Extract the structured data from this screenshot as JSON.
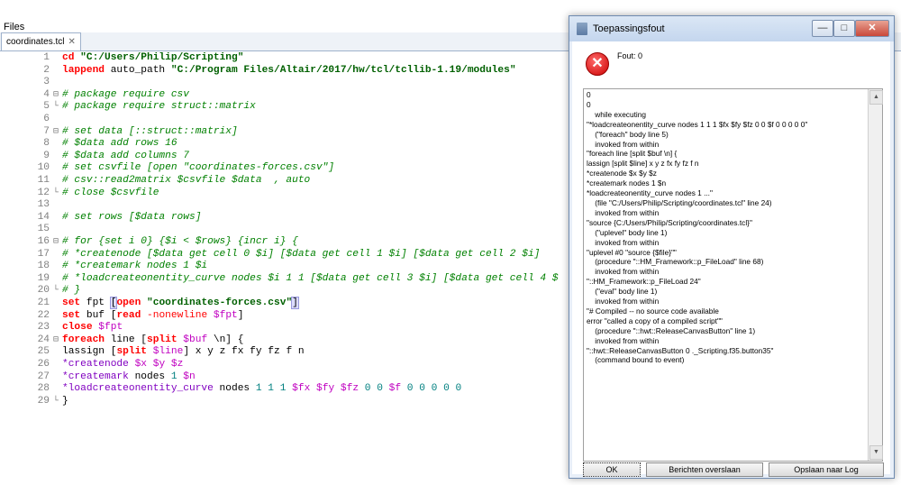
{
  "files_label": "Files",
  "tab": {
    "label": "coordinates.tcl",
    "close": "✕"
  },
  "code_lines": [
    {
      "n": "1",
      "fold": "",
      "html": "<span class=\"kw\">cd</span> <span class=\"strb\">\"C:/Users/Philip/Scripting\"</span>"
    },
    {
      "n": "2",
      "fold": "",
      "html": "<span class=\"kw\">lappend</span> auto_path <span class=\"strb\">\"C:/Program Files/Altair/2017/hw/tcl/tcllib-1.19/modules\"</span>"
    },
    {
      "n": "3",
      "fold": "",
      "html": ""
    },
    {
      "n": "4",
      "fold": "⊟",
      "html": "<span class=\"cm\"># package require csv</span>"
    },
    {
      "n": "5",
      "fold": "└",
      "html": "<span class=\"cm\"># package require struct::matrix</span>"
    },
    {
      "n": "6",
      "fold": "",
      "html": ""
    },
    {
      "n": "7",
      "fold": "⊟",
      "html": "<span class=\"cm\"># set data [::struct::matrix]</span>"
    },
    {
      "n": "8",
      "fold": "",
      "html": "<span class=\"cm\"># $data add rows 16</span>"
    },
    {
      "n": "9",
      "fold": "",
      "html": "<span class=\"cm\"># $data add columns 7</span>"
    },
    {
      "n": "10",
      "fold": "",
      "html": "<span class=\"cm\"># set csvfile [open \"coordinates-forces.csv\"]</span>"
    },
    {
      "n": "11",
      "fold": "",
      "html": "<span class=\"cm\"># csv::read2matrix $csvfile $data  , auto</span>"
    },
    {
      "n": "12",
      "fold": "└",
      "html": "<span class=\"cm\"># close $csvfile</span>"
    },
    {
      "n": "13",
      "fold": "",
      "html": ""
    },
    {
      "n": "14",
      "fold": "",
      "html": "<span class=\"cm\"># set rows [$data rows]</span>"
    },
    {
      "n": "15",
      "fold": "",
      "html": ""
    },
    {
      "n": "16",
      "fold": "⊟",
      "html": "<span class=\"cm\"># for {set i 0} {$i &lt; $rows} {incr i} {</span>"
    },
    {
      "n": "17",
      "fold": "",
      "html": "<span class=\"cm\"># *createnode [$data get cell 0 $i] [$data get cell 1 $i] [$data get cell 2 $i]</span>"
    },
    {
      "n": "18",
      "fold": "",
      "html": "<span class=\"cm\"># *createmark nodes 1 $i</span>"
    },
    {
      "n": "19",
      "fold": "",
      "html": "<span class=\"cm\"># *loadcreateonentity_curve nodes $i 1 1 [$data get cell 3 $i] [$data get cell 4 $</span>"
    },
    {
      "n": "20",
      "fold": "└",
      "html": "<span class=\"cm\"># }</span>"
    },
    {
      "n": "21",
      "fold": "",
      "html": "<span class=\"kw\">set</span> fpt <span class=\"hl\">[</span><span class=\"kw\">open</span> <span class=\"strb\">\"coordinates-forces.csv\"</span><span class=\"hl\">]</span>"
    },
    {
      "n": "22",
      "fold": "",
      "html": "<span class=\"kw\">set</span> buf [<span class=\"kw\">read</span> <span class=\"kw2\">-nonewline</span> <span class=\"var\">$fpt</span>]"
    },
    {
      "n": "23",
      "fold": "",
      "html": "<span class=\"kw\">close</span> <span class=\"var\">$fpt</span>"
    },
    {
      "n": "24",
      "fold": "⊟",
      "html": "<span class=\"kw\">foreach</span> line [<span class=\"kw\">split</span> <span class=\"var\">$buf</span> \\n] {"
    },
    {
      "n": "25",
      "fold": "",
      "html": "lassign [<span class=\"kw\">split</span> <span class=\"var\">$line</span>] x y z fx fy fz f n"
    },
    {
      "n": "26",
      "fold": "",
      "html": "<span class=\"cmd\">*createnode</span> <span class=\"var\">$x</span> <span class=\"var\">$y</span> <span class=\"var\">$z</span>"
    },
    {
      "n": "27",
      "fold": "",
      "html": "<span class=\"cmd\">*createmark</span> nodes <span class=\"num\">1</span> <span class=\"var\">$n</span>"
    },
    {
      "n": "28",
      "fold": "",
      "html": "<span class=\"cmd\">*loadcreateonentity_curve</span> nodes <span class=\"num\">1 1 1</span> <span class=\"var\">$fx</span> <span class=\"var\">$fy</span> <span class=\"var\">$fz</span> <span class=\"num\">0 0</span> <span class=\"var\">$f</span> <span class=\"num\">0 0 0 0 0</span>"
    },
    {
      "n": "29",
      "fold": "└",
      "html": "}"
    }
  ],
  "dialog": {
    "title": "Toepassingsfout",
    "window_buttons": {
      "minimize": "—",
      "maximize": "□",
      "close": "✕"
    },
    "error_icon": "✕",
    "error_message": "Fout: 0",
    "trace_lines": [
      "0",
      "0",
      "    while executing",
      "\"*loadcreateonentity_curve nodes 1 1 1 $fx $fy $fz 0 0 $f 0 0 0 0 0\"",
      "    (\"foreach\" body line 5)",
      "    invoked from within",
      "\"foreach line [split $buf \\n] {",
      "lassign [split $line] x y z fx fy fz f n",
      "*createnode $x $y $z",
      "*createmark nodes 1 $n",
      "*loadcreateonentity_curve nodes 1 ...\"",
      "    (file \"C:/Users/Philip/Scripting/coordinates.tcl\" line 24)",
      "    invoked from within",
      "\"source {C:/Users/Philip/Scripting/coordinates.tcl}\"",
      "    (\"uplevel\" body line 1)",
      "    invoked from within",
      "\"uplevel #0 \"source {$file}\"\"",
      "    (procedure \"::HM_Framework::p_FileLoad\" line 68)",
      "    invoked from within",
      "\"::HM_Framework::p_FileLoad 24\"",
      "    (\"eval\" body line 1)",
      "    invoked from within",
      "\"# Compiled -- no source code available",
      "error \"called a copy of a compiled script\"\"",
      "    (procedure \"::hwt::ReleaseCanvasButton\" line 1)",
      "    invoked from within",
      "\"::hwt::ReleaseCanvasButton 0 ._Scripting.f35.button35\"",
      "    (command bound to event)"
    ],
    "buttons": {
      "ok": "OK",
      "skip": "Berichten overslaan",
      "save_log": "Opslaan naar Log"
    },
    "scroll_up": "▲",
    "scroll_down": "▼"
  }
}
